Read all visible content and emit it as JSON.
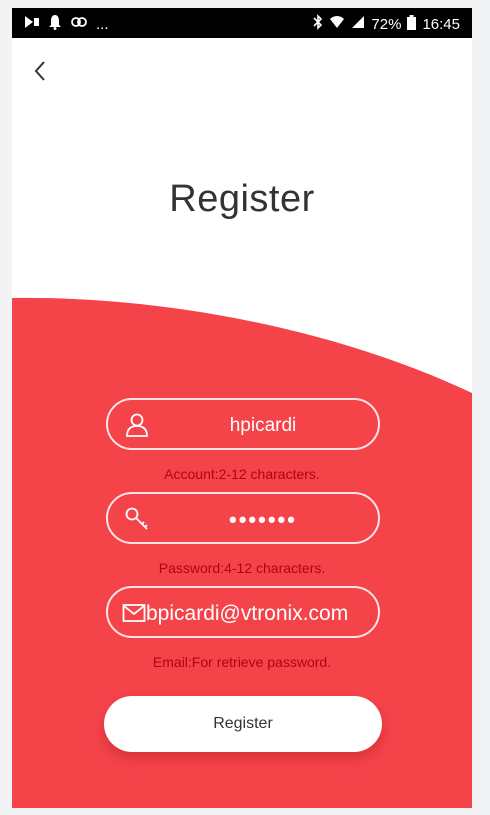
{
  "status_bar": {
    "left_more": "...",
    "battery": "72%",
    "time": "16:45"
  },
  "header": {
    "title": "Register"
  },
  "form": {
    "account": {
      "value": "hpicardi",
      "hint": "Account:2-12 characters."
    },
    "password": {
      "value": "•••••••",
      "hint": "Password:4-12 characters."
    },
    "email": {
      "value": "bpicardi@vtronix.com",
      "hint": "Email:For retrieve password."
    },
    "register_label": "Register"
  },
  "colors": {
    "accent": "#f5434a",
    "hint": "#b8000e",
    "status_bar": "#000000"
  },
  "icons": {
    "back": "chevron-left-icon",
    "account": "user-icon",
    "password": "key-icon",
    "email": "mail-icon"
  }
}
